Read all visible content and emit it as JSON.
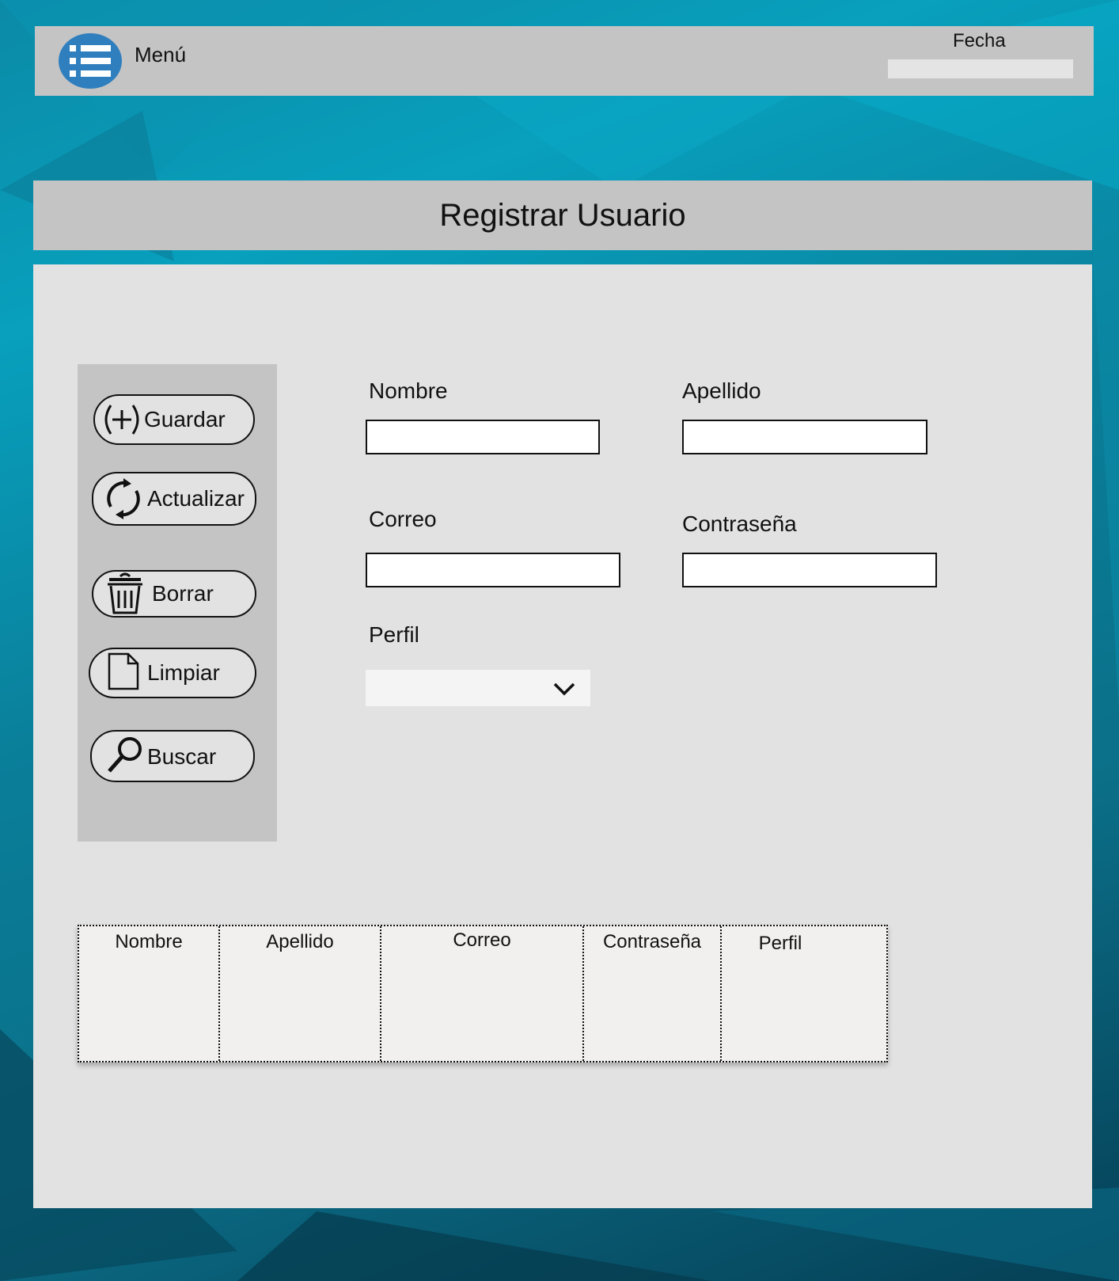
{
  "topbar": {
    "menu_label": "Menú",
    "date_label": "Fecha",
    "date_value": ""
  },
  "page": {
    "title": "Registrar Usuario"
  },
  "actions": {
    "save": "Guardar",
    "update": "Actualizar",
    "delete": "Borrar",
    "clear": "Limpiar",
    "search": "Buscar"
  },
  "form": {
    "nombre_label": "Nombre",
    "apellido_label": "Apellido",
    "correo_label": "Correo",
    "contrasena_label": "Contraseña",
    "perfil_label": "Perfil",
    "perfil_selected": ""
  },
  "table": {
    "columns": [
      "Nombre",
      "Apellido",
      "Correo",
      "Contraseña",
      "Perfil"
    ],
    "rows": []
  },
  "icons": {
    "menu": "list-icon",
    "save": "plus-circle-icon",
    "update": "refresh-icon",
    "delete": "trash-icon",
    "clear": "document-icon",
    "search": "magnifier-icon",
    "perfil_dropdown": "chevron-down-icon"
  },
  "colors": {
    "menu_button": "#2f7fbf",
    "bar": "#c4c4c4",
    "panel": "#e2e2e2"
  }
}
